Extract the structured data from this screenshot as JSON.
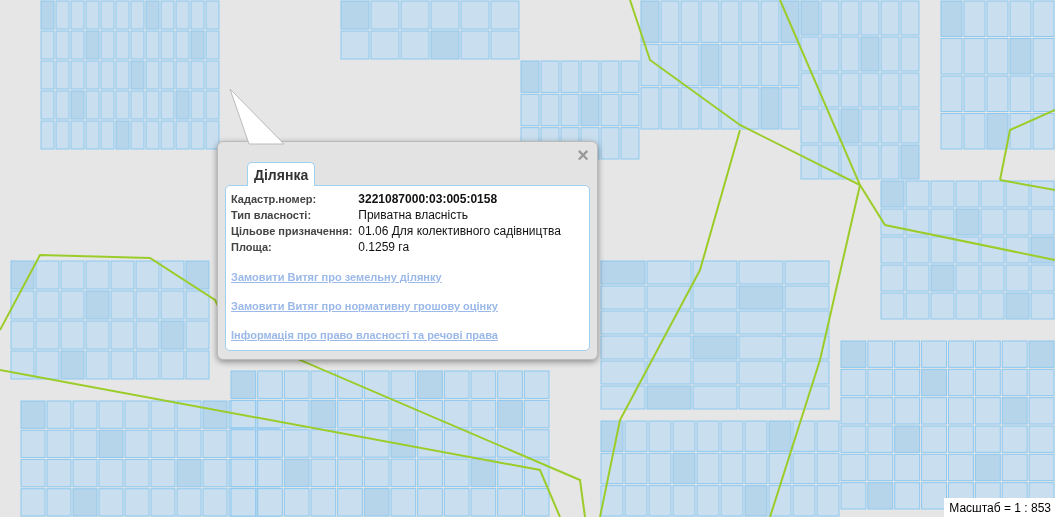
{
  "popup": {
    "tabs": [
      {
        "label": "Ділянка",
        "selected": true
      }
    ],
    "close": "×",
    "fields": [
      {
        "label": "Кадастр.номер:",
        "value": "3221087000:03:005:0158",
        "bold": true
      },
      {
        "label": "Тип власності:",
        "value": "Приватна власність",
        "bold": false
      },
      {
        "label": "Цільове призначення:",
        "value": "01.06 Для колективного садівництва",
        "bold": false
      },
      {
        "label": "Площа:",
        "value": "0.1259 га",
        "bold": false
      }
    ],
    "links": [
      "Замовити Витяг про земельну ділянку",
      "Замовити Витяг про нормативну грошову оцінку",
      "Інформація про право власності та речові права"
    ]
  },
  "scale": "Масштаб = 1 : 853"
}
